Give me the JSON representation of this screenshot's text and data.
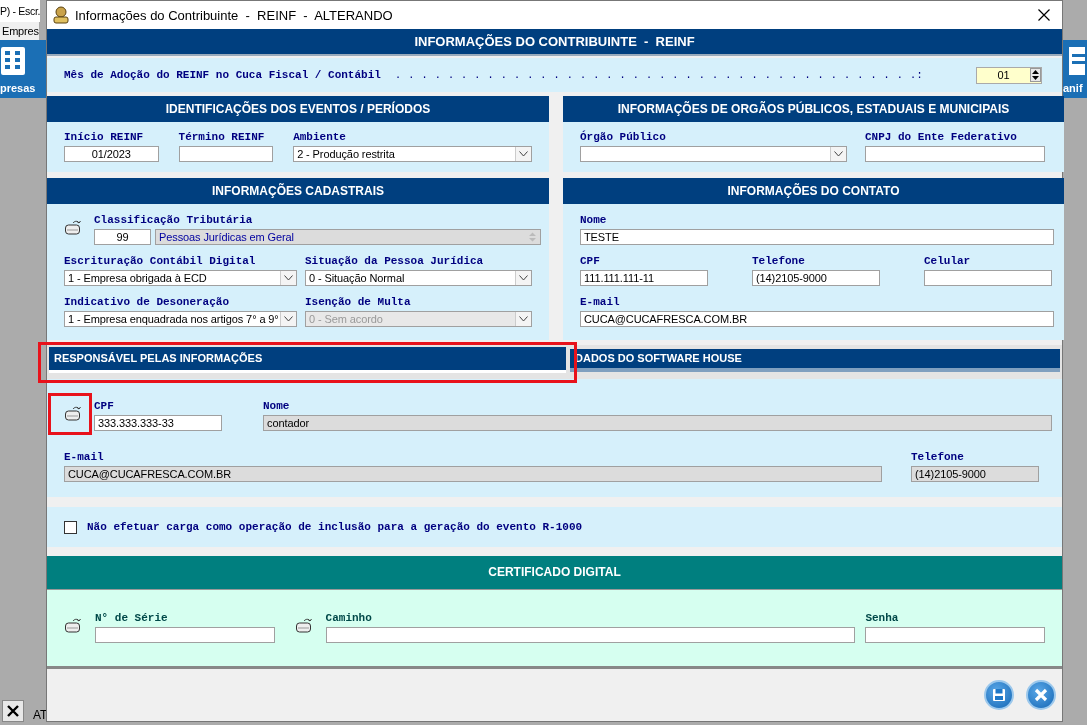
{
  "background_app": {
    "title": "P) - Escr.",
    "menu": "Empres",
    "left_tile": "presas",
    "right_tile": "anif",
    "status_text": "AT"
  },
  "window": {
    "title": "Informações do Contribuinte  -  REINF  -  ALTERANDO"
  },
  "header": "INFORMAÇÕES DO CONTRIBUINTE  -  REINF",
  "adoption": {
    "label": "Mês de Adoção do REINF no Cuca Fiscal / Contábil",
    "leader": ". . . . . . . . . . . . . . . . . . . . . . . . . . . . . . . . . . . . . . . .:",
    "value": "01"
  },
  "events": {
    "title": "IDENTIFICAÇÕES DOS EVENTOS / PERÍODOS",
    "inicio": {
      "label": "Início REINF",
      "value": "01/2023"
    },
    "termino": {
      "label": "Término REINF"
    },
    "ambiente": {
      "label": "Ambiente",
      "value": "2 - Produção restrita",
      "disabled": false
    }
  },
  "orgaos": {
    "title": "INFORMAÇÕES DE ORGÃOS PÚBLICOS, ESTADUAIS E MUNICIPAIS",
    "orgao": {
      "label": "Órgão Público",
      "disabled": false
    },
    "cnpj": {
      "label": "CNPJ do Ente Federativo"
    }
  },
  "cadastrais": {
    "title": "INFORMAÇÕES CADASTRAIS",
    "classificacao": {
      "label": "Classificação Tributária",
      "code": "99",
      "value": "Pessoas Jurídicas em Geral"
    },
    "ecd": {
      "label": "Escrituração Contábil Digital",
      "value": "1 - Empresa obrigada à ECD",
      "disabled": false
    },
    "situacao": {
      "label": "Situação da Pessoa Jurídica",
      "value": "0 - Situação Normal",
      "disabled": false
    },
    "desoneracao": {
      "label": "Indicativo de Desoneração",
      "value": "1 - Empresa enquadrada nos artigos 7° a 9°",
      "disabled": false
    },
    "multa": {
      "label": "Isenção de Multa",
      "value": "0 - Sem acordo",
      "disabled": true
    }
  },
  "contato": {
    "title": "INFORMAÇÕES DO CONTATO",
    "nome": {
      "label": "Nome",
      "value": "TESTE"
    },
    "cpf": {
      "label": "CPF",
      "value": "111.111.111-11"
    },
    "telefone": {
      "label": "Telefone",
      "value": "(14)2105-9000"
    },
    "celular": {
      "label": "Celular"
    },
    "email": {
      "label": "E-mail",
      "value": "CUCA@CUCAFRESCA.COM.BR"
    }
  },
  "tabs": [
    {
      "label": "RESPONSÁVEL PELAS INFORMAÇÕES",
      "selected": true
    },
    {
      "label": "DADOS DO SOFTWARE HOUSE",
      "selected": false
    }
  ],
  "responsavel": {
    "cpf": {
      "label": "CPF",
      "value": "333.333.333-33",
      "readonly": false
    },
    "nome": {
      "label": "Nome",
      "value": "contador",
      "readonly": true
    },
    "email": {
      "label": "E-mail",
      "value": "CUCA@CUCAFRESCA.COM.BR",
      "readonly": true
    },
    "telefone": {
      "label": "Telefone",
      "value": "(14)2105-9000",
      "readonly": true
    }
  },
  "carga": {
    "label": "Não efetuar carga como operação de inclusão para a geração do evento R-1000",
    "checked": false
  },
  "certificado": {
    "title": "CERTIFICADO DIGITAL",
    "serie": {
      "label": "N° de Série"
    },
    "caminho": {
      "label": "Caminho"
    },
    "senha": {
      "label": "Senha"
    }
  }
}
